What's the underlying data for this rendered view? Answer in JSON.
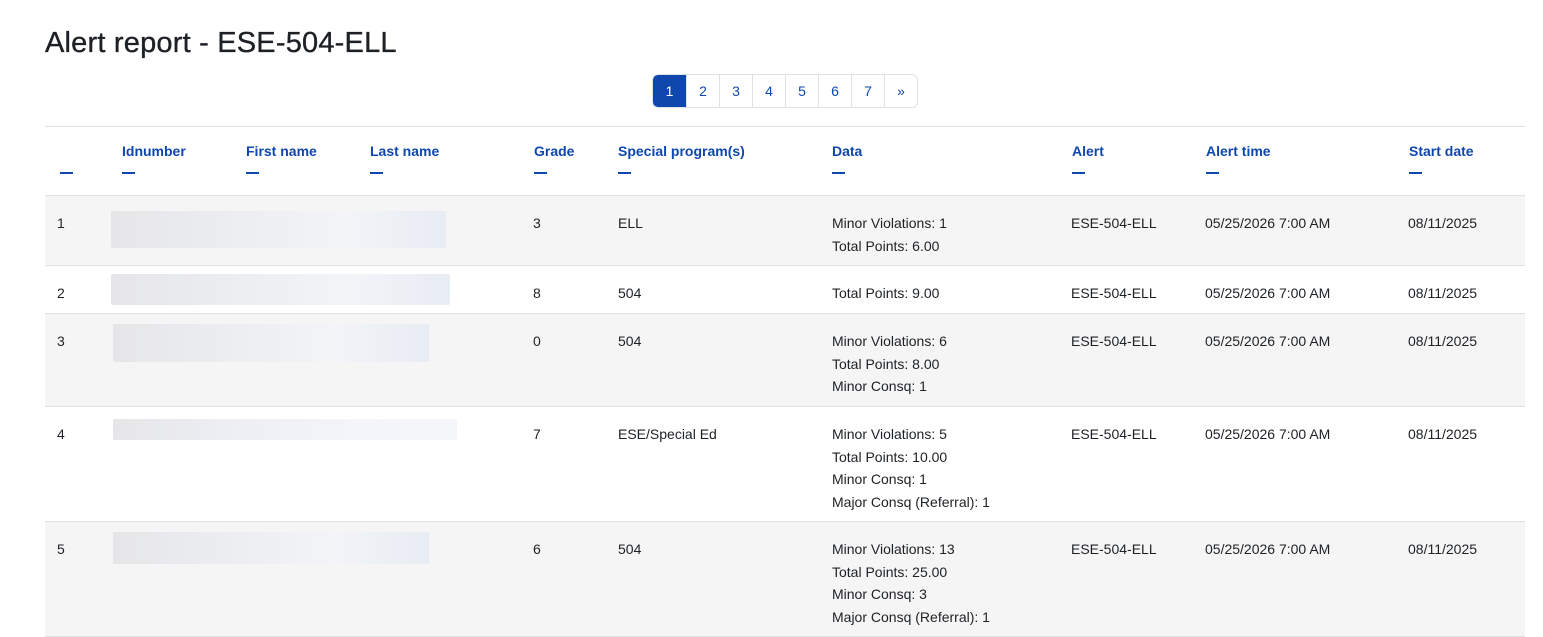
{
  "title": "Alert report - ESE-504-ELL",
  "pagination": {
    "pages": [
      "1",
      "2",
      "3",
      "4",
      "5",
      "6",
      "7"
    ],
    "active": "1",
    "next": "»"
  },
  "columns": {
    "row_num": "",
    "idnumber": "Idnumber",
    "firstname": "First name",
    "lastname": "Last name",
    "grade": "Grade",
    "special_programs": "Special program(s)",
    "data": "Data",
    "alert": "Alert",
    "alert_time": "Alert time",
    "start_date": "Start date"
  },
  "rows": [
    {
      "num": "1",
      "grade": "3",
      "program": "ELL",
      "data": [
        "Minor Violations: 1",
        "Total Points: 6.00"
      ],
      "alert": "ESE-504-ELL",
      "alert_time": "05/25/2026 7:00 AM",
      "start_date": "08/11/2025"
    },
    {
      "num": "2",
      "grade": "8",
      "program": "504",
      "data": [
        "Total Points: 9.00"
      ],
      "alert": "ESE-504-ELL",
      "alert_time": "05/25/2026 7:00 AM",
      "start_date": "08/11/2025"
    },
    {
      "num": "3",
      "grade": "0",
      "program": "504",
      "data": [
        "Minor Violations: 6",
        "Total Points: 8.00",
        "Minor Consq: 1"
      ],
      "alert": "ESE-504-ELL",
      "alert_time": "05/25/2026 7:00 AM",
      "start_date": "08/11/2025"
    },
    {
      "num": "4",
      "grade": "7",
      "program": "ESE/Special Ed",
      "data": [
        "Minor Violations: 5",
        "Total Points: 10.00",
        "Minor Consq: 1",
        "Major Consq (Referral): 1"
      ],
      "alert": "ESE-504-ELL",
      "alert_time": "05/25/2026 7:00 AM",
      "start_date": "08/11/2025"
    },
    {
      "num": "5",
      "grade": "6",
      "program": "504",
      "data": [
        "Minor Violations: 13",
        "Total Points: 25.00",
        "Minor Consq: 3",
        "Major Consq (Referral): 1"
      ],
      "alert": "ESE-504-ELL",
      "alert_time": "05/25/2026 7:00 AM",
      "start_date": "08/11/2025"
    }
  ]
}
